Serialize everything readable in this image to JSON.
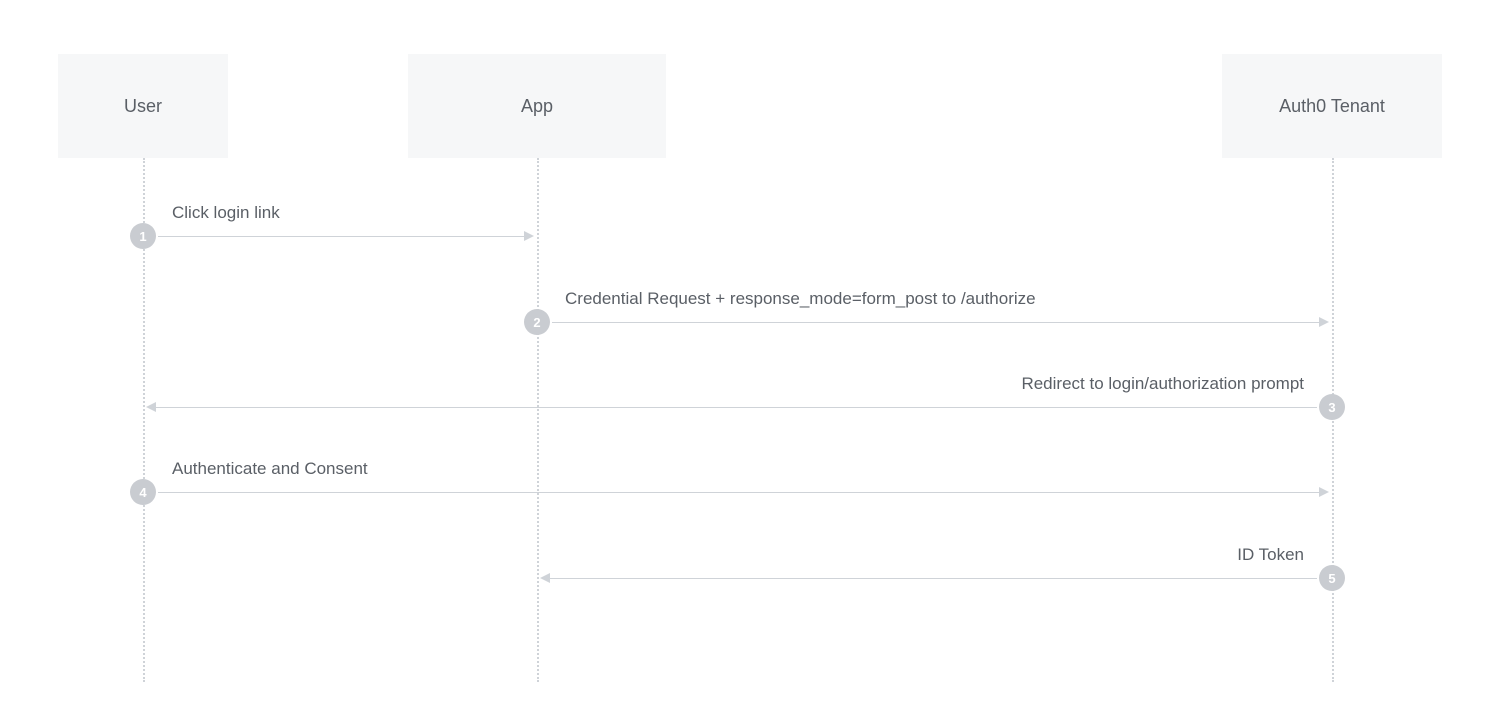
{
  "actors": {
    "user": "User",
    "app": "App",
    "tenant": "Auth0 Tenant"
  },
  "steps": {
    "s1": {
      "num": "1",
      "label": "Click login link"
    },
    "s2": {
      "num": "2",
      "label": "Credential Request + response_mode=form_post to /authorize"
    },
    "s3": {
      "num": "3",
      "label": "Redirect to login/authorization prompt"
    },
    "s4": {
      "num": "4",
      "label": "Authenticate and Consent"
    },
    "s5": {
      "num": "5",
      "label": "ID Token"
    }
  }
}
